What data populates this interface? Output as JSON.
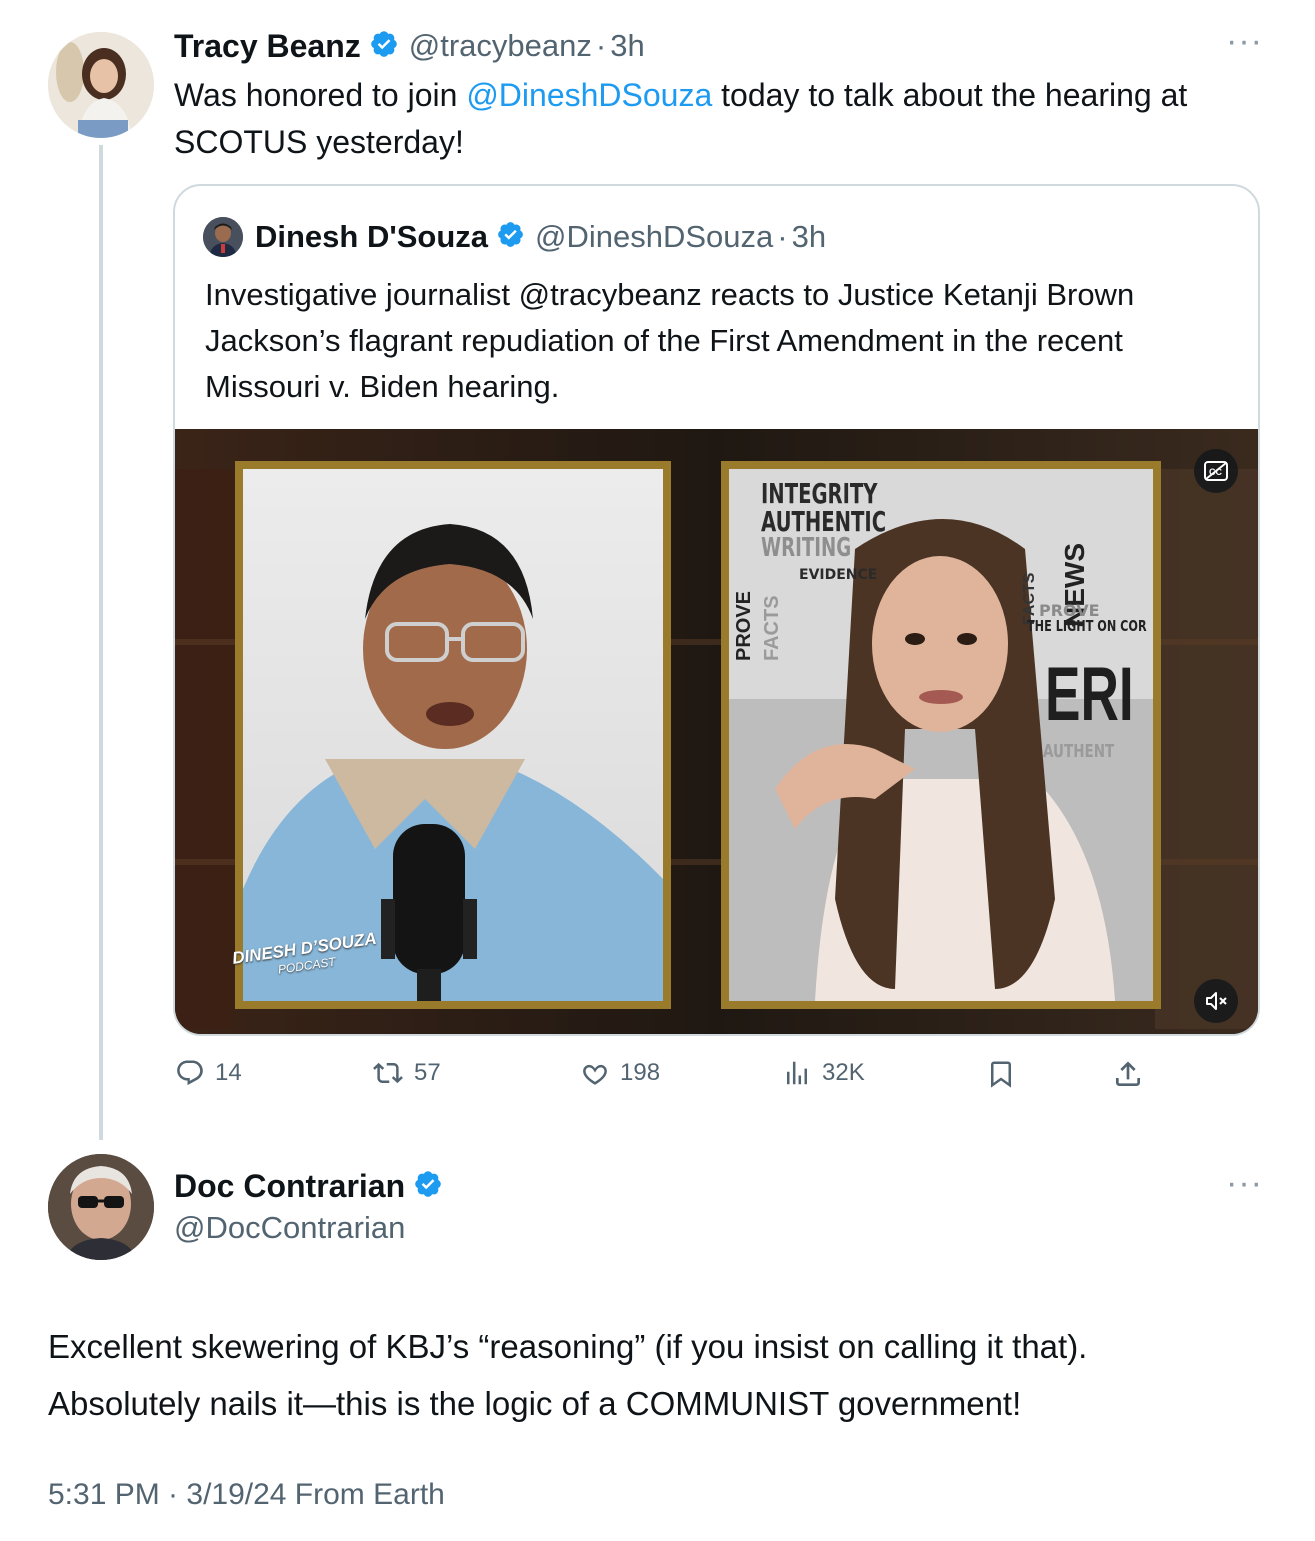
{
  "original_tweet": {
    "author_name": "Tracy Beanz",
    "handle": "@tracybeanz",
    "separator": "·",
    "time": "3h",
    "text_before": "Was honored to join ",
    "mention": "@DineshDSouza",
    "text_after_line1": " today to talk about the hearing at",
    "text_line2": "SCOTUS yesterday!",
    "more_label": "···"
  },
  "quoted_tweet": {
    "author_name": "Dinesh D'Souza",
    "handle": "@DineshDSouza",
    "separator": "·",
    "time": "3h",
    "text_lines": [
      "Investigative journalist @tracybeanz reacts to Justice Ketanji Brown",
      "Jackson’s flagrant repudiation of the First Amendment in the recent",
      "Missouri v. Biden hearing."
    ],
    "video": {
      "left_caption_line1": "DINESH D’SOUZA",
      "left_caption_line2": "PODCAST",
      "backdrop_words": [
        "INTEGRITY",
        "AUTHENTIC",
        "WRITING",
        "EVIDENCE",
        "PROVE",
        "FACTS",
        "NEWS",
        "FACTS",
        "PROVE",
        "THE LIGHT ON COR",
        "ERI",
        "AUTHENT"
      ],
      "cc_icon": "closed-captions-icon",
      "volume_icon": "volume-muted-icon"
    }
  },
  "actions": {
    "replies": "14",
    "reposts": "57",
    "likes": "198",
    "views": "32K"
  },
  "reply_tweet": {
    "author_name": "Doc Contrarian",
    "handle": "@DocContrarian",
    "more_label": "···",
    "text_line1": "Excellent skewering of KBJ’s “reasoning” (if you insist on calling it that).",
    "text_line2": "Absolutely nails it—this is the logic of a COMMUNIST government!",
    "timestamp": "5:31 PM · 3/19/24 From Earth"
  },
  "colors": {
    "accent": "#1d9bf0",
    "text": "#0f1419",
    "muted": "#536471",
    "border": "#cfd9de"
  }
}
